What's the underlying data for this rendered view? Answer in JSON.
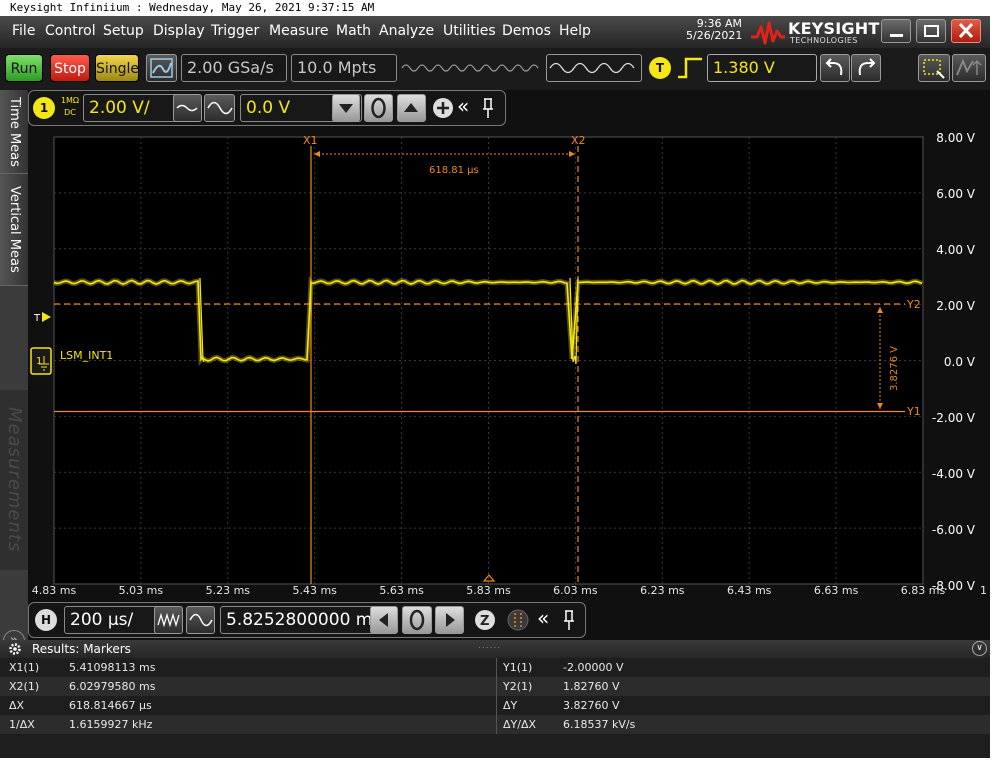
{
  "caption": "Keysight Infiniium : Wednesday, May 26, 2021 9:37:15 AM",
  "menu": [
    "File",
    "Control",
    "Setup",
    "Display",
    "Trigger",
    "Measure",
    "Math",
    "Analyze",
    "Utilities",
    "Demos",
    "Help"
  ],
  "clock": {
    "time": "9:36 AM",
    "date": "5/26/2021"
  },
  "brand": {
    "name": "KEYSIGHT",
    "sub": "TECHNOLOGIES",
    "color": "#e2231a"
  },
  "toolbar": {
    "run": "Run",
    "stop": "Stop",
    "single": "Single",
    "sample_rate": "2.00 GSa/s",
    "memory_depth": "10.0 Mpts",
    "trigger_badge": "T",
    "trigger_level": "1.380 V"
  },
  "side_tabs": {
    "time_meas": "Time Meas",
    "vertical_meas": "Vertical Meas",
    "measurements": "Measurements"
  },
  "channel": {
    "number": "1",
    "coupling_top": "1MΩ",
    "coupling_bottom": "DC",
    "scale": "2.00 V/",
    "offset": "0.0 V",
    "color": "#f5e617"
  },
  "scope": {
    "x_ticks": [
      "4.83 ms",
      "5.03 ms",
      "5.23 ms",
      "5.43 ms",
      "5.63 ms",
      "5.83 ms",
      "6.03 ms",
      "6.23 ms",
      "6.43 ms",
      "6.63 ms",
      "6.83 ms"
    ],
    "x_tick_extra": "1",
    "y_ticks": [
      "8.00 V",
      "6.00 V",
      "4.00 V",
      "2.00 V",
      "0.0 V",
      "-2.00 V",
      "-4.00 V",
      "-6.00 V",
      "-8.00 V"
    ],
    "marker_x1": "X1",
    "marker_x2": "X2",
    "marker_y1": "Y1",
    "marker_y2": "Y2",
    "delta_x_label": "618.81 µs",
    "delta_y_label": "3.8276 V",
    "trigger_marker": "T",
    "signal_label": "LSM_INT1",
    "signal_color": "#f5e617",
    "marker_color": "#f08a1c"
  },
  "horizontal": {
    "badge": "H",
    "scale": "200 µs/",
    "position": "5.8252800000 ms"
  },
  "results": {
    "title": "Results: Markers",
    "rows": [
      {
        "l_label": "X1(1)",
        "l_value": "5.41098113 ms",
        "r_label": "Y1(1)",
        "r_value": "-2.00000 V"
      },
      {
        "l_label": "X2(1)",
        "l_value": "6.02979580 ms",
        "r_label": "Y2(1)",
        "r_value": "1.82760 V"
      },
      {
        "l_label": "ΔX",
        "l_value": "618.814667 µs",
        "r_label": "ΔY",
        "r_value": "3.82760 V"
      },
      {
        "l_label": "1/ΔX",
        "l_value": "1.6159927 kHz",
        "r_label": "ΔY/ΔX",
        "r_value": "6.18537 kV/s"
      }
    ]
  }
}
